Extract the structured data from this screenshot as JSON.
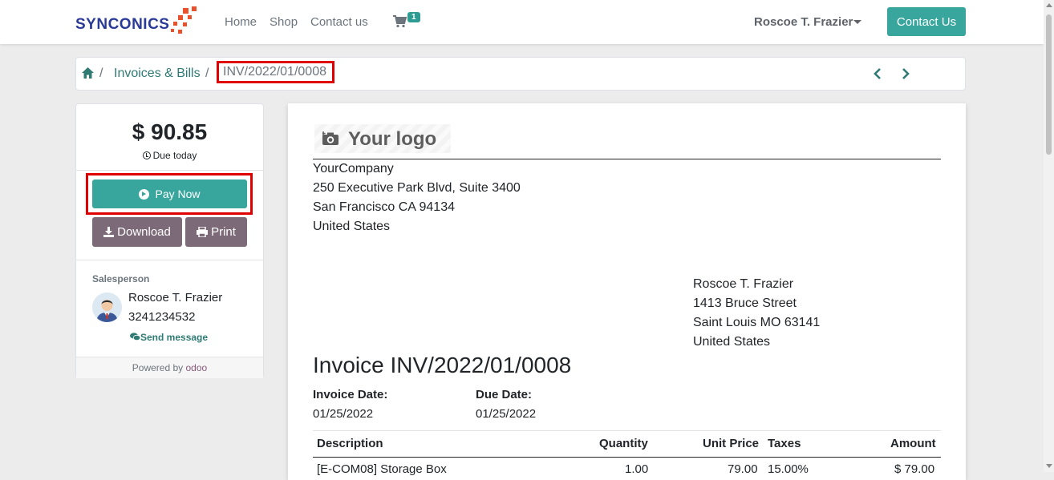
{
  "navbar": {
    "logo_text": "SYNCONICS",
    "links": [
      "Home",
      "Shop",
      "Contact us"
    ],
    "cart_count": "1",
    "user_name": "Roscoe T. Frazier",
    "contact_button": "Contact Us",
    "colors": {
      "accent": "#39a69e",
      "logo_blue": "#2a3a96",
      "logo_orange": "#e8512b"
    }
  },
  "breadcrumb": {
    "home_icon": "home-icon",
    "section": "Invoices & Bills",
    "separator": "/",
    "current": "INV/2022/01/0008"
  },
  "sidebar": {
    "amount": "$ 90.85",
    "due": "Due today",
    "pay_button": "Pay Now",
    "download_button": "Download",
    "print_button": "Print",
    "salesperson_label": "Salesperson",
    "salesperson_name": "Roscoe T. Frazier",
    "salesperson_phone": "3241234532",
    "send_message": "Send message",
    "powered_by": "Powered by",
    "powered_brand": "odoo"
  },
  "invoice": {
    "logo_placeholder": "Your logo",
    "company": [
      "YourCompany",
      "250 Executive Park Blvd, Suite 3400",
      "San Francisco CA 94134",
      "United States"
    ],
    "customer": [
      "Roscoe T. Frazier",
      "1413 Bruce Street",
      "Saint Louis MO 63141",
      "United States"
    ],
    "title": "Invoice INV/2022/01/0008",
    "invoice_date_label": "Invoice Date:",
    "invoice_date": "01/25/2022",
    "due_date_label": "Due Date:",
    "due_date": "01/25/2022",
    "table": {
      "headers": [
        "Description",
        "Quantity",
        "Unit Price",
        "Taxes",
        "Amount"
      ],
      "rows": [
        [
          "[E-COM08] Storage Box",
          "1.00",
          "79.00",
          "15.00%",
          "$ 79.00"
        ]
      ]
    }
  }
}
